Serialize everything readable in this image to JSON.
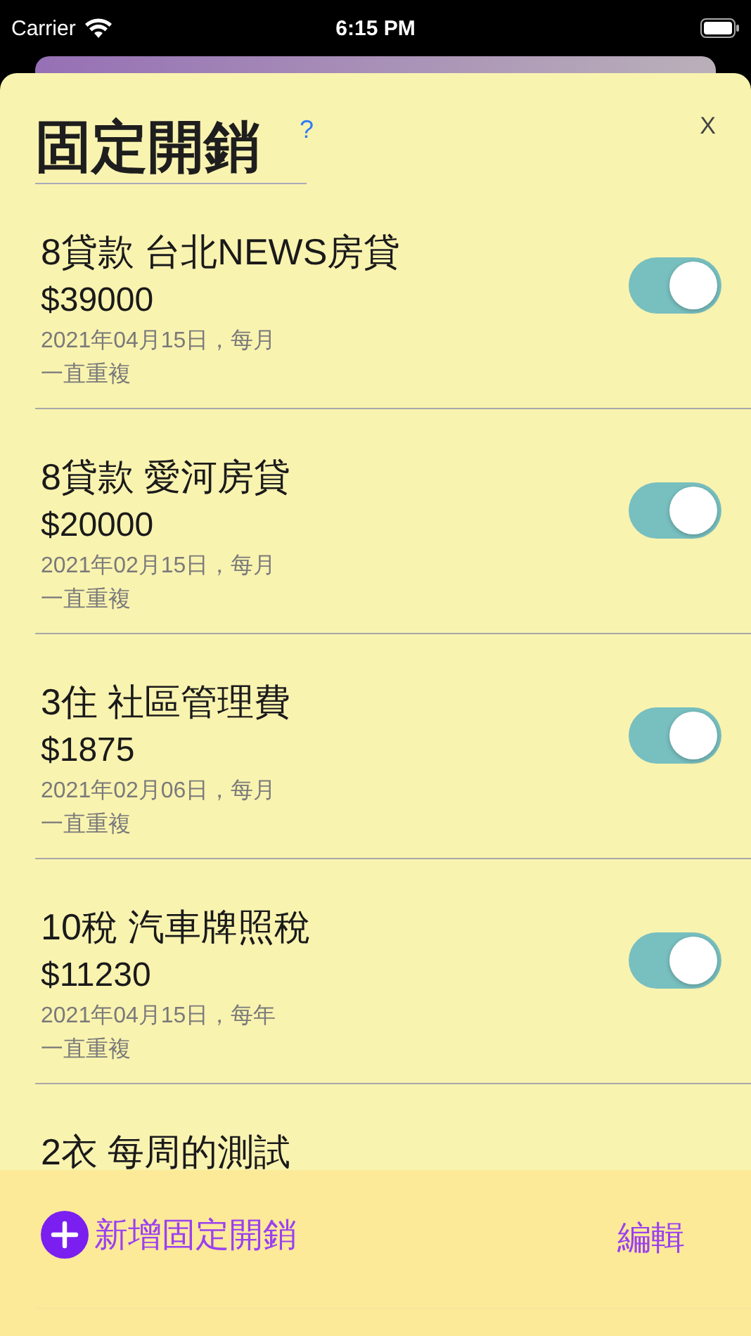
{
  "status_bar": {
    "carrier": "Carrier",
    "time": "6:15 PM"
  },
  "sheet": {
    "title": "固定開銷",
    "help": "?",
    "close": "X"
  },
  "expenses": [
    {
      "title": "8貸款 台北NEWS房貸",
      "amount": "$39000",
      "schedule": "2021年04月15日，每月",
      "repeat": "一直重複",
      "on": true
    },
    {
      "title": "8貸款 愛河房貸",
      "amount": "$20000",
      "schedule": "2021年02月15日，每月",
      "repeat": "一直重複",
      "on": true
    },
    {
      "title": "3住 社區管理費",
      "amount": "$1875",
      "schedule": "2021年02月06日，每月",
      "repeat": "一直重複",
      "on": true
    },
    {
      "title": "10稅 汽車牌照稅",
      "amount": "$11230",
      "schedule": "2021年04月15日，每年",
      "repeat": "一直重複",
      "on": true
    },
    {
      "title": "2衣  每周的測試"
    }
  ],
  "bottom_bar": {
    "add": "新增固定開銷",
    "edit": "編輯"
  }
}
